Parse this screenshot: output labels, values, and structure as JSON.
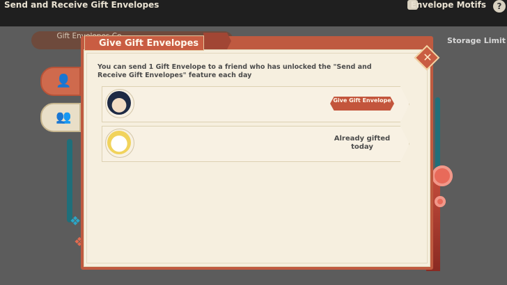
{
  "topbar": {
    "title": "Send and Receive Gift Envelopes",
    "motifs_label": "Envelope Motifs",
    "help_symbol": "?"
  },
  "background": {
    "tab_text": "Gift Envelopes Co",
    "storage_label": "Storage Limit"
  },
  "dialog": {
    "title": "Give Gift Envelopes",
    "close_symbol": "✕",
    "description": "You can send 1 Gift Envelope to a friend who has unlocked the \"Send and Receive Gift Envelopes\" feature each day",
    "friends": [
      {
        "avatar": "dark-haired-character-avatar",
        "action_label": "Give Gift Envelope",
        "status": ""
      },
      {
        "avatar": "white-cat-avatar",
        "action_label": "",
        "status": "Already gifted today"
      }
    ]
  },
  "side_tabs": [
    {
      "icon": "single-person-icon",
      "active": true
    },
    {
      "icon": "friends-icon",
      "active": false
    }
  ],
  "colors": {
    "accent_red": "#c95d42",
    "panel_cream": "#f6efdf",
    "ribbon_teal": "#1f6f7a"
  }
}
